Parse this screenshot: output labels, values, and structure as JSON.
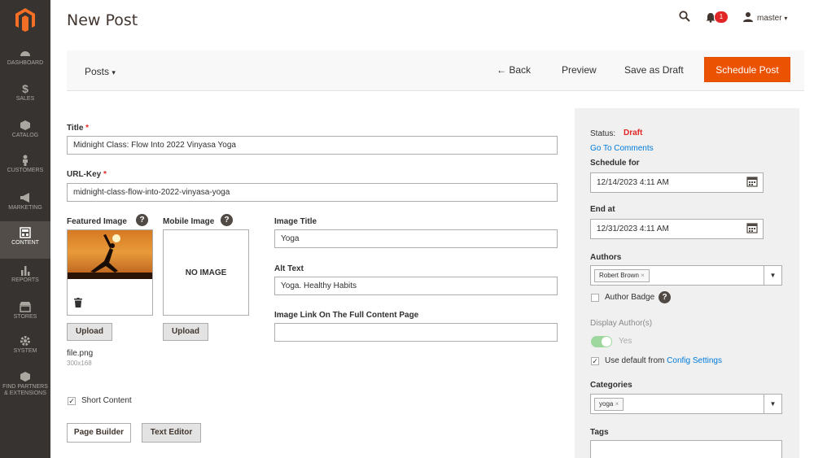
{
  "sidebar": {
    "items": [
      {
        "label": "DASHBOARD",
        "icon": "dashboard-icon"
      },
      {
        "label": "SALES",
        "icon": "dollar-icon"
      },
      {
        "label": "CATALOG",
        "icon": "box-icon"
      },
      {
        "label": "CUSTOMERS",
        "icon": "person-icon"
      },
      {
        "label": "MARKETING",
        "icon": "megaphone-icon"
      },
      {
        "label": "CONTENT",
        "icon": "content-icon"
      },
      {
        "label": "REPORTS",
        "icon": "bar-chart-icon"
      },
      {
        "label": "STORES",
        "icon": "store-icon"
      },
      {
        "label": "SYSTEM",
        "icon": "gear-icon"
      },
      {
        "label": "FIND PARTNERS & EXTENSIONS",
        "icon": "partners-icon"
      }
    ],
    "active_index": 5
  },
  "header": {
    "title": "New Post",
    "notification_count": "1",
    "user": "master"
  },
  "toolbar": {
    "posts_label": "Posts",
    "back_label": "Back",
    "preview_label": "Preview",
    "draft_label": "Save as Draft",
    "schedule_label": "Schedule Post"
  },
  "form": {
    "title_label": "Title",
    "title_value": "Midnight Class: Flow Into 2022 Vinyasa Yoga",
    "urlkey_label": "URL-Key",
    "urlkey_value": "midnight-class-flow-into-2022-vinyasa-yoga",
    "featured_label": "Featured Image",
    "mobile_label": "Mobile Image",
    "no_image": "NO IMAGE",
    "upload_label": "Upload",
    "file_name": "file.png",
    "file_dims": "300x168",
    "image_title_label": "Image Title",
    "image_title_value": "Yoga",
    "alt_label": "Alt Text",
    "alt_value": "Yoga. Healthy Habits",
    "link_label": "Image Link On The Full Content Page",
    "link_value": "",
    "short_content_label": "Short Content",
    "page_builder_label": "Page Builder",
    "text_editor_label": "Text Editor"
  },
  "panel": {
    "status_label": "Status:",
    "status_value": "Draft",
    "comments_link": "Go To Comments",
    "schedule_label": "Schedule for",
    "schedule_value": "12/14/2023 4:11 AM",
    "end_label": "End at",
    "end_value": "12/31/2023 4:11 AM",
    "authors_label": "Authors",
    "author_tag": "Robert Brown",
    "author_badge_label": "Author Badge",
    "display_authors_label": "Display Author(s)",
    "toggle_label": "Yes",
    "use_default_label": "Use default from",
    "config_link": "Config Settings",
    "categories_label": "Categories",
    "category_tag": "yoga",
    "tags_label": "Tags"
  },
  "colors": {
    "accent": "#eb5202",
    "sidebar": "#373330",
    "link": "#007bdb",
    "status": "#e22626"
  }
}
